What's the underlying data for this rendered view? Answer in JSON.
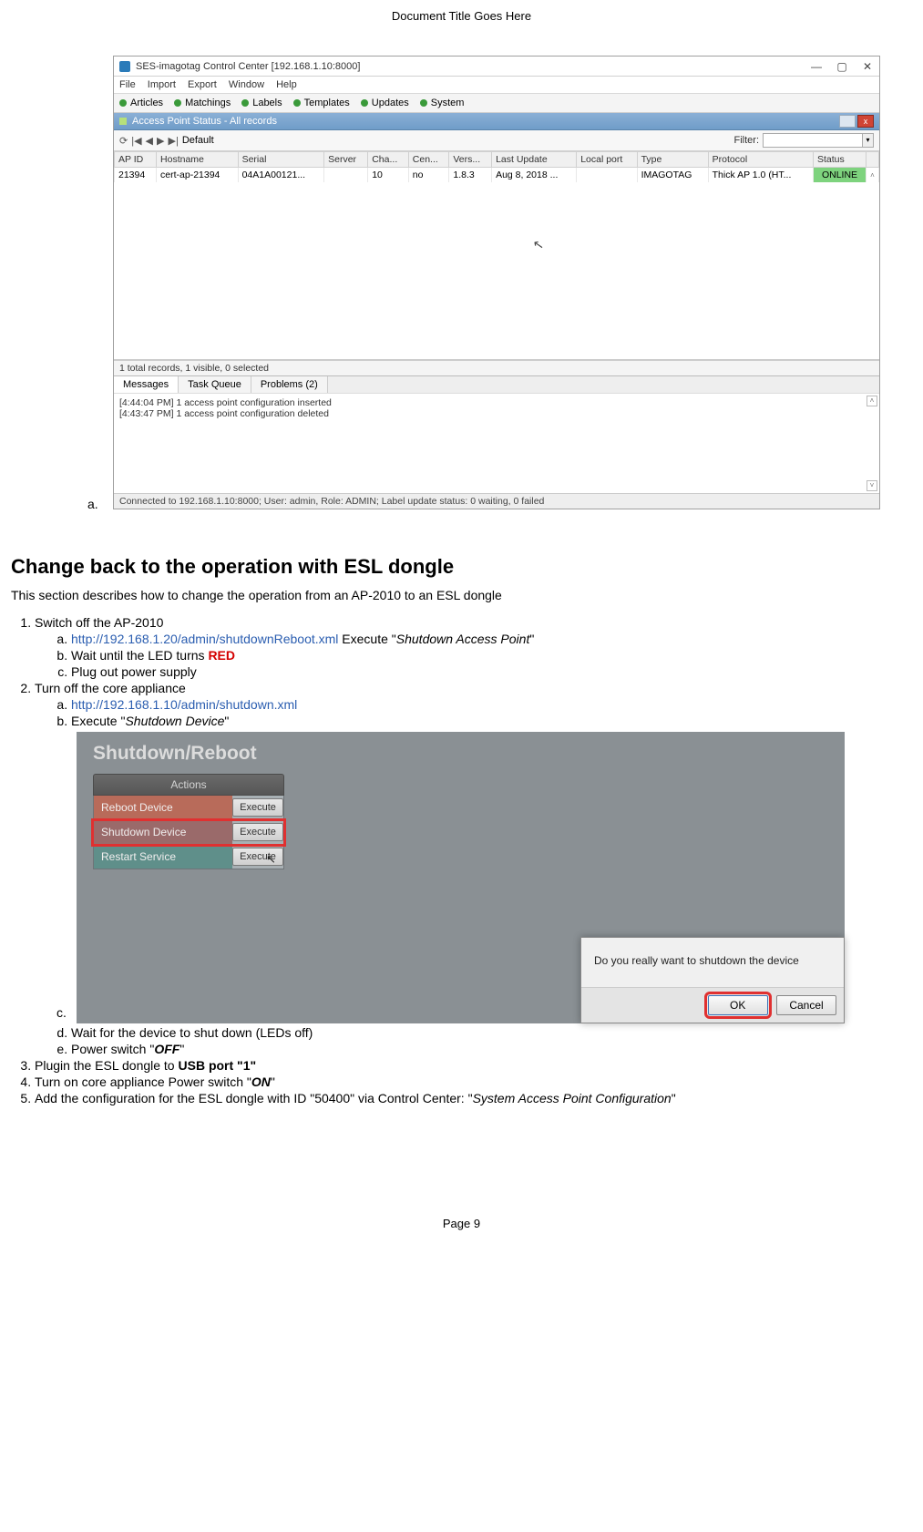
{
  "doc": {
    "header": "Document Title Goes Here",
    "footer": "Page 9"
  },
  "screenshot1": {
    "title": "SES-imagotag Control Center [192.168.1.10:8000]",
    "win_min": "—",
    "win_max": "▢",
    "win_close": "✕",
    "menu": [
      "File",
      "Import",
      "Export",
      "Window",
      "Help"
    ],
    "tabs": [
      "Articles",
      "Matchings",
      "Labels",
      "Templates",
      "Updates",
      "System"
    ],
    "panel_title": "Access Point Status - All records",
    "nav_refresh": "⟳",
    "nav_first": "|◀",
    "nav_prev": "◀",
    "nav_next": "▶",
    "nav_last": "▶|",
    "default_label": "Default",
    "filter_label": "Filter:",
    "filter_value": "",
    "columns": [
      "AP ID",
      "Hostname",
      "Serial",
      "Server",
      "Cha...",
      "Cen...",
      "Vers...",
      "Last Update",
      "Local port",
      "Type",
      "Protocol",
      "Status"
    ],
    "row": {
      "ap_id": "21394",
      "hostname": "cert-ap-21394",
      "serial": "04A1A00121...",
      "server": "",
      "channel": "10",
      "center": "no",
      "version": "1.8.3",
      "last_update": "Aug 8, 2018 ...",
      "local_port": "",
      "type": "IMAGOTAG",
      "protocol": "Thick AP 1.0 (HT...",
      "status": "ONLINE"
    },
    "records_line": "1 total records, 1 visible, 0 selected",
    "bottom_tabs": [
      "Messages",
      "Task Queue",
      "Problems (2)"
    ],
    "log1": "[4:44:04 PM]  1 access point configuration inserted",
    "log2": "[4:43:47 PM]  1 access point configuration deleted",
    "conn": "Connected to 192.168.1.10:8000; User: admin, Role: ADMIN; Label update status: 0 waiting, 0 failed",
    "label_a": "a."
  },
  "section": {
    "heading": "Change back to the operation with ESL dongle",
    "intro": "This section describes how to change the operation from an AP-2010 to an ESL dongle",
    "step1": "Switch off the AP-2010",
    "step1a_link": "http://192.168.1.20/admin/shutdownReboot.xml",
    "step1a_rest1": "  Execute \"",
    "step1a_em": "Shutdown Access Point",
    "step1a_rest2": "\"",
    "step1b_1": "Wait until the LED turns ",
    "step1b_red": "RED",
    "step1c": "Plug out power supply",
    "step2": "Turn off the core appliance",
    "step2a_link": "http://192.168.1.10/admin/shutdown.xml",
    "step2b_1": "Execute \"",
    "step2b_em": "Shutdown Device",
    "step2b_2": "\"",
    "step2c_label": "c.",
    "step2d": "Wait for the device to shut down (LEDs off)",
    "step2e_1": "Power switch \"",
    "step2e_b": "OFF",
    "step2e_2": "\"",
    "step3_1": "Plugin the ESL dongle to ",
    "step3_b": "USB port \"1\"",
    "step4_1": "Turn on core appliance  Power switch \"",
    "step4_b": "ON",
    "step4_2": "\"",
    "step5_1": "Add the configuration for the ESL dongle with ID \"50400\" via Control Center: \"",
    "step5_em": "System  Access Point Configuration",
    "step5_2": "\""
  },
  "screenshot2": {
    "title": "Shutdown/Reboot",
    "actions_header": "Actions",
    "row1_label": "Reboot Device",
    "row2_label": "Shutdown Device",
    "row3_label": "Restart Service",
    "btn_label": "Execute",
    "dialog_msg": "Do you really want to shutdown the device",
    "ok": "OK",
    "cancel": "Cancel"
  }
}
